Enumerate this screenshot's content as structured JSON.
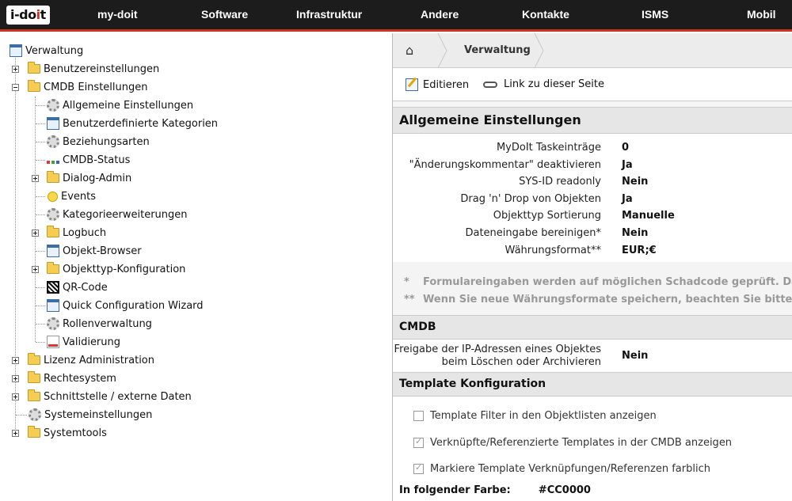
{
  "nav": {
    "logo_a": "i-do",
    "logo_dot": "i",
    "logo_b": "t",
    "items": [
      "my-doit",
      "Software",
      "Infrastruktur",
      "Andere",
      "Kontakte",
      "ISMS",
      "Mobil"
    ]
  },
  "tree": {
    "root": "Verwaltung",
    "items": [
      "Benutzereinstellungen",
      "CMDB Einstellungen",
      "Allgemeine Einstellungen",
      "Benutzerdefinierte Kategorien",
      "Beziehungsarten",
      "CMDB-Status",
      "Dialog-Admin",
      "Events",
      "Kategorieerweiterungen",
      "Logbuch",
      "Objekt-Browser",
      "Objekttyp-Konfiguration",
      "QR-Code",
      "Quick Configuration Wizard",
      "Rollenverwaltung",
      "Validierung",
      "Lizenz Administration",
      "Rechtesystem",
      "Schnittstelle / externe Daten",
      "Systemeinstellungen",
      "Systemtools"
    ]
  },
  "breadcrumb": {
    "current": "Verwaltung"
  },
  "toolbar": {
    "edit": "Editieren",
    "link": "Link zu dieser Seite"
  },
  "general": {
    "title": "Allgemeine Einstellungen",
    "rows": [
      {
        "label": "MyDoIt Taskeinträge",
        "value": "0"
      },
      {
        "label": "\"Änderungskommentar\" deaktivieren",
        "value": "Ja"
      },
      {
        "label": "SYS-ID readonly",
        "value": "Nein"
      },
      {
        "label": "Drag 'n' Drop von Objekten",
        "value": "Ja"
      },
      {
        "label": "Objekttyp Sortierung",
        "value": "Manuelle"
      },
      {
        "label": "Dateneingabe bereinigen*",
        "value": "Nein"
      },
      {
        "label": "Währungsformat**",
        "value": "EUR;€"
      }
    ],
    "notes": [
      {
        "mark": "*",
        "text": "Formulareingaben werden auf möglichen Schadcode geprüft. Das"
      },
      {
        "mark": "**",
        "text": "Wenn Sie neue Währungsformate speichern, beachten Sie bitte f"
      }
    ]
  },
  "cmdb": {
    "title": "CMDB",
    "label_1": "Freigabe der IP-Adressen eines Objektes",
    "label_2": "beim Löschen oder Archivieren",
    "value": "Nein"
  },
  "template": {
    "title": "Template Konfiguration",
    "checkboxes": [
      {
        "label": "Template Filter in den Objektlisten anzeigen",
        "checked": false
      },
      {
        "label": "Verknüpfte/Referenzierte Templates in der CMDB anzeigen",
        "checked": true
      },
      {
        "label": "Markiere Template Verknüpfungen/Referenzen farblich",
        "checked": true
      }
    ],
    "color_label": "In folgender Farbe:",
    "color_value": "#CC0000"
  }
}
